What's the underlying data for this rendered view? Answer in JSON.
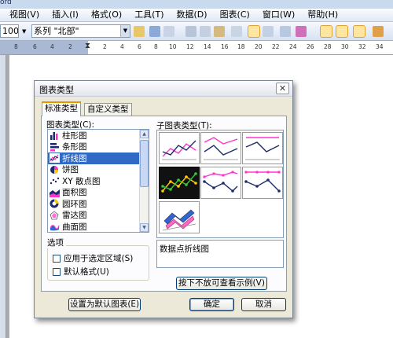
{
  "window": {
    "title_fragment": "ord"
  },
  "menubar": {
    "items": [
      "视图(V)",
      "插入(I)",
      "格式(O)",
      "工具(T)",
      "数据(D)",
      "图表(C)",
      "窗口(W)",
      "帮助(H)"
    ]
  },
  "toolbar": {
    "zoom_value": "100%",
    "series_value": "系列 \"北部\""
  },
  "ruler": {
    "numbers": [
      "8",
      "6",
      "4",
      "2",
      "2",
      "4",
      "6",
      "8",
      "10",
      "12",
      "14",
      "16",
      "18",
      "20",
      "22",
      "24",
      "26",
      "28",
      "30",
      "32",
      "34"
    ]
  },
  "dialog": {
    "title": "图表类型",
    "close_glyph": "✕",
    "tabs": [
      {
        "label": "标准类型",
        "active": true
      },
      {
        "label": "自定义类型",
        "active": false
      }
    ],
    "chart_type_label": "图表类型(C):",
    "chart_types": [
      {
        "label": "柱形图",
        "icon": "column-chart-icon"
      },
      {
        "label": "条形图",
        "icon": "bar-chart-icon"
      },
      {
        "label": "折线图",
        "icon": "line-chart-icon",
        "selected": true
      },
      {
        "label": "饼图",
        "icon": "pie-chart-icon"
      },
      {
        "label": "XY 散点图",
        "icon": "xy-scatter-chart-icon"
      },
      {
        "label": "面积图",
        "icon": "area-chart-icon"
      },
      {
        "label": "圆环图",
        "icon": "doughnut-chart-icon"
      },
      {
        "label": "雷达图",
        "icon": "radar-chart-icon"
      },
      {
        "label": "曲面图",
        "icon": "surface-chart-icon"
      }
    ],
    "subtype_label": "子图表类型(T):",
    "options_label": "选项",
    "options": [
      {
        "label": "应用于选定区域(S)",
        "checked": false
      },
      {
        "label": "默认格式(U)",
        "checked": false
      }
    ],
    "description": "数据点折线图",
    "preview_button": "按下不放可查看示例(V)",
    "default_button": "设置为默认图表(E)",
    "ok_button": "确定",
    "cancel_button": "取消",
    "colors": {
      "selection": "#316ac5",
      "series_pink": "#ff33cc",
      "series_navy": "#1f2a6e"
    }
  }
}
